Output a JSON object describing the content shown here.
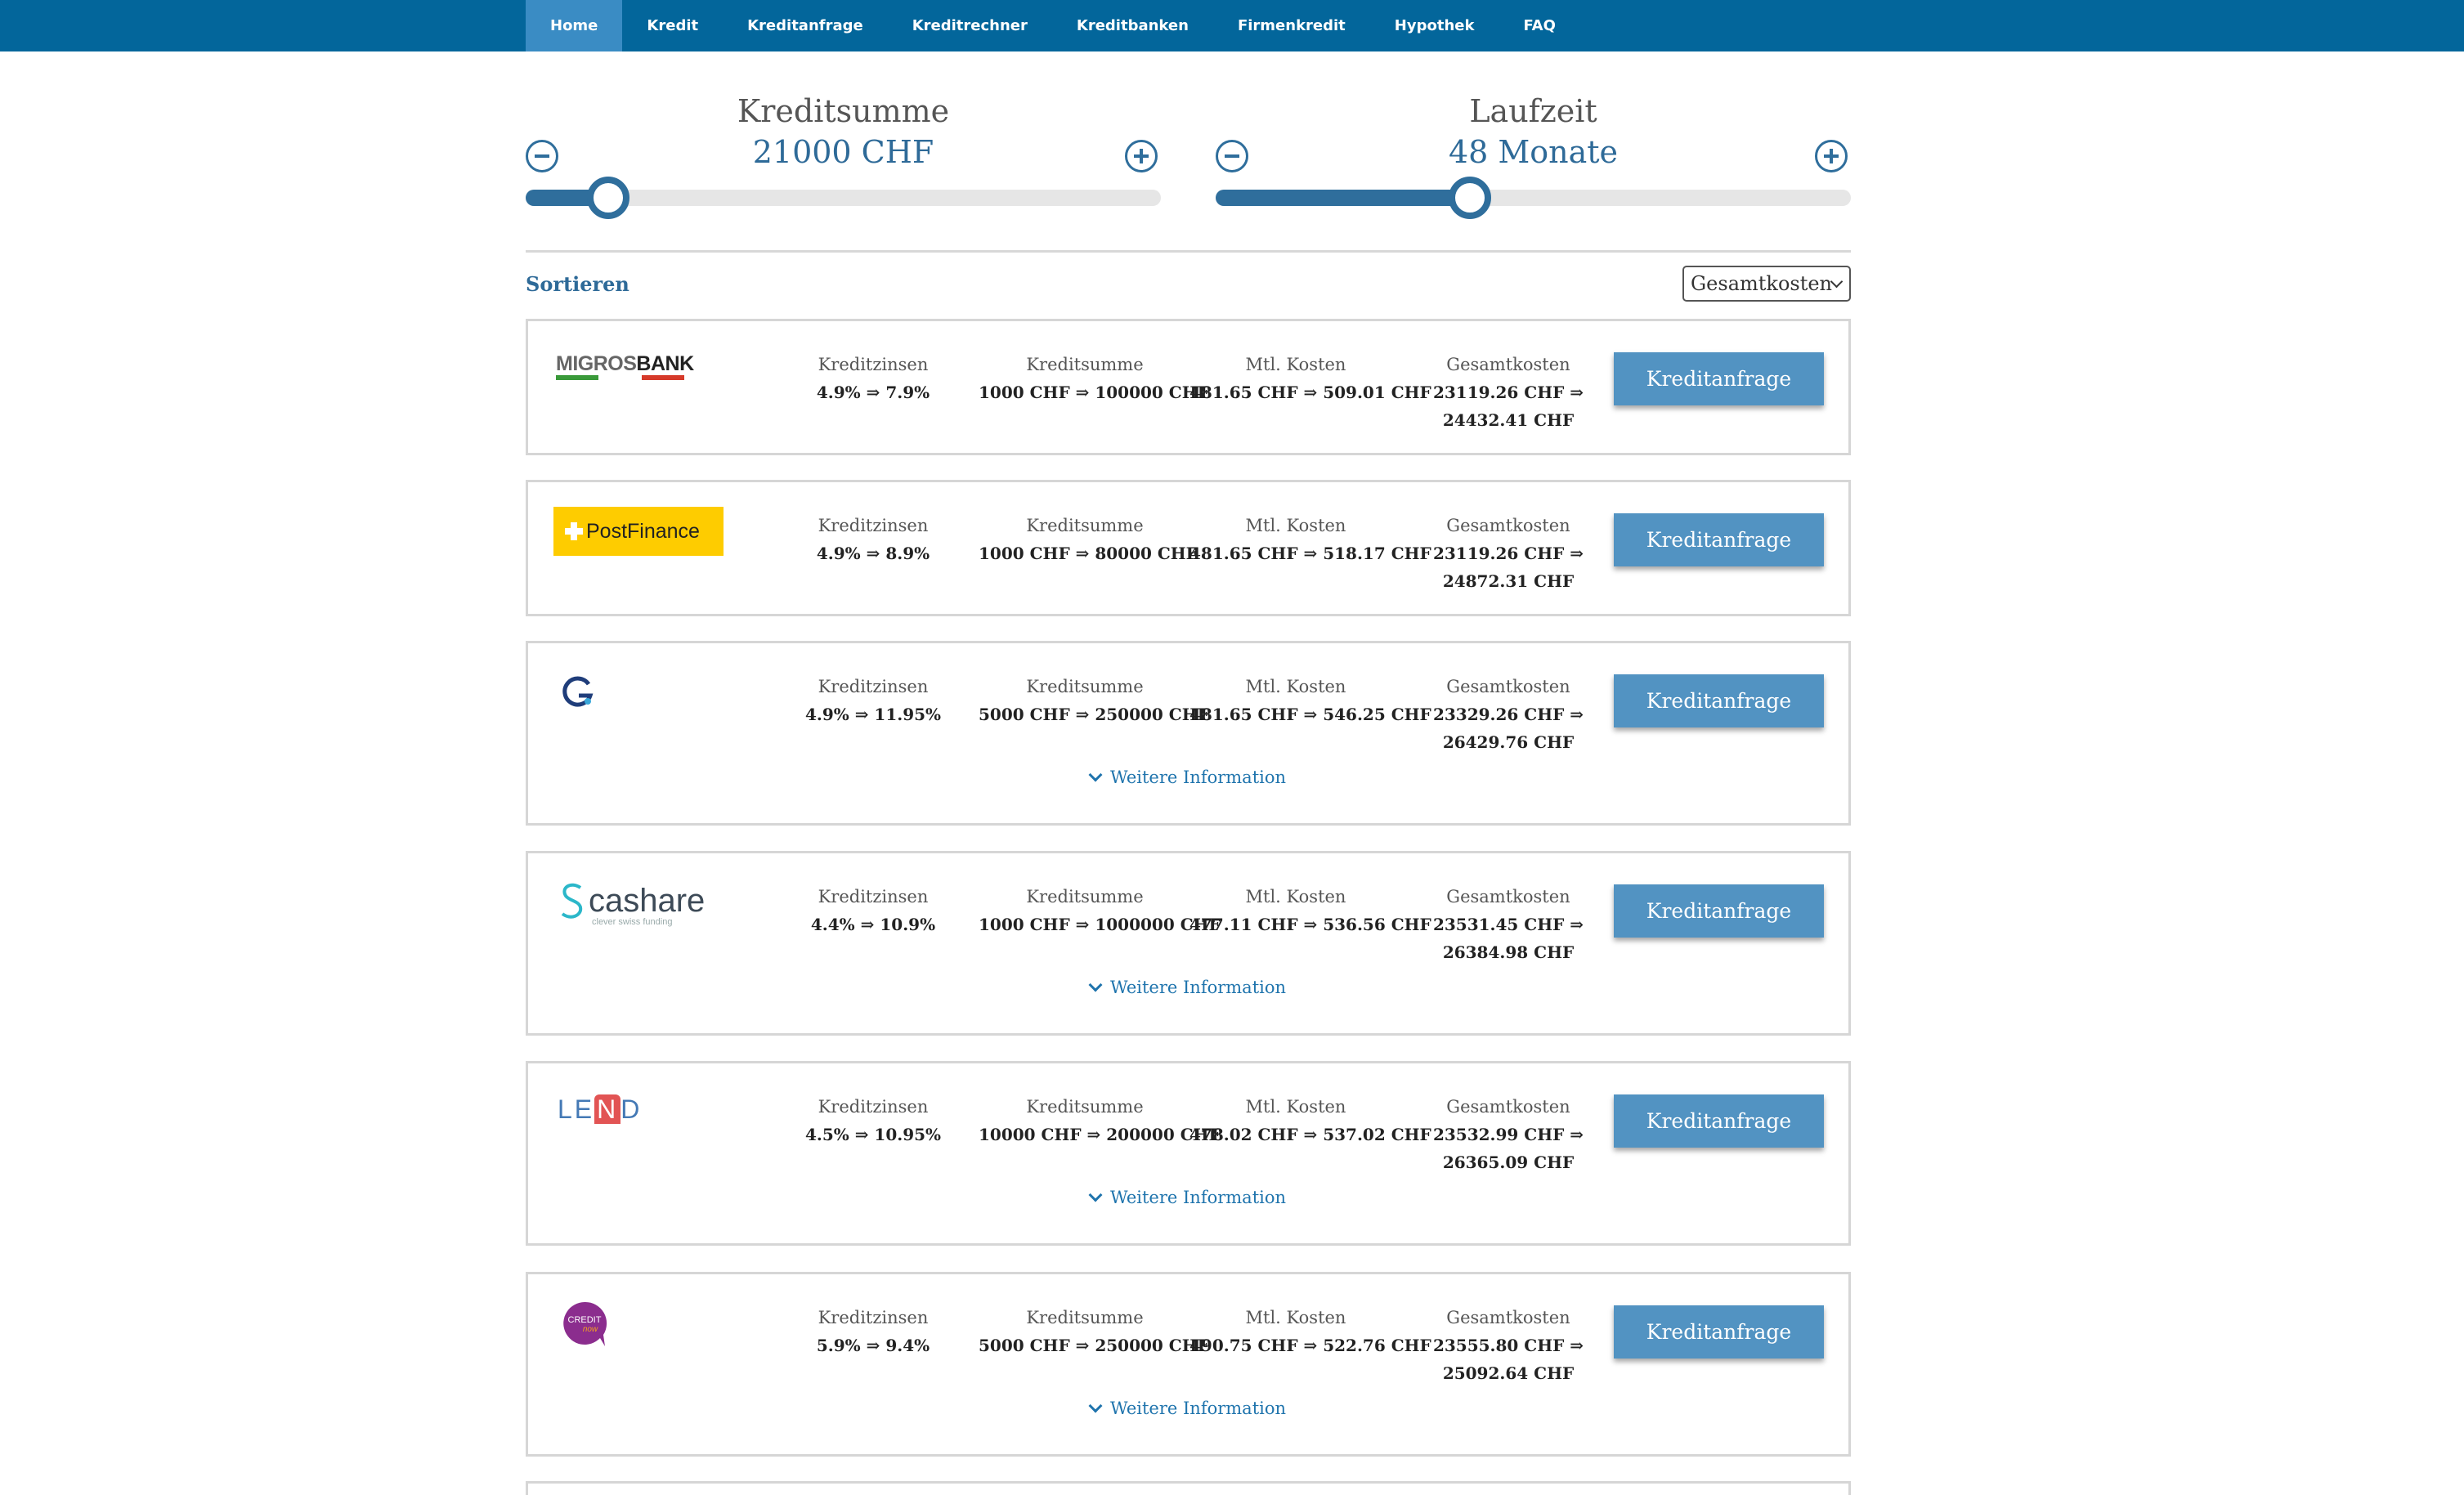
{
  "nav": {
    "items": [
      "Home",
      "Kredit",
      "Kreditanfrage",
      "Kreditrechner",
      "Kreditbanken",
      "Firmenkredit",
      "Hypothek",
      "FAQ"
    ],
    "active_index": 0
  },
  "sliders": {
    "amount": {
      "title": "Kreditsumme",
      "value": "21000 CHF",
      "level": 0.13
    },
    "term": {
      "title": "Laufzeit",
      "value": "48 Monate",
      "level": 0.4
    }
  },
  "sort": {
    "label": "Sortieren",
    "selected": "Gesamtkosten"
  },
  "column_labels": {
    "zinsen": "Kreditzinsen",
    "summe": "Kreditsumme",
    "kosten": "Mtl. Kosten",
    "gesamt": "Gesamtkosten"
  },
  "button_label": "Kreditanfrage",
  "more_label": "Weitere Information",
  "offers": [
    {
      "logo": "MIGROSBANK",
      "logo_a": "MIGROS",
      "logo_b": "BANK",
      "zinsen": "4.9% ⇒ 7.9%",
      "summe": "1000 CHF ⇒ 100000 CHF",
      "kosten": "481.65 CHF ⇒ 509.01 CHF",
      "gesamt1": "23119.26 CHF ⇒",
      "gesamt2": "24432.41 CHF"
    },
    {
      "logo": "PostFinance",
      "zinsen": "4.9% ⇒ 8.9%",
      "summe": "1000 CHF ⇒ 80000 CHF",
      "kosten": "481.65 CHF ⇒ 518.17 CHF",
      "gesamt1": "23119.26 CHF ⇒",
      "gesamt2": "24872.31 CHF"
    },
    {
      "logo": "G",
      "zinsen": "4.9% ⇒ 11.95%",
      "summe": "5000 CHF ⇒ 250000 CHF",
      "kosten": "481.65 CHF ⇒ 546.25 CHF",
      "gesamt1": "23329.26 CHF ⇒",
      "gesamt2": "26429.76 CHF"
    },
    {
      "logo": "cashare",
      "logo_sub": "clever swiss funding",
      "zinsen": "4.4% ⇒ 10.9%",
      "summe": "1000 CHF ⇒ 1000000 CHF",
      "kosten": "477.11 CHF ⇒ 536.56 CHF",
      "gesamt1": "23531.45 CHF ⇒",
      "gesamt2": "26384.98 CHF"
    },
    {
      "logo": "LEND",
      "logo_a": "LE",
      "logo_n": "N",
      "logo_b": "D",
      "zinsen": "4.5% ⇒ 10.95%",
      "summe": "10000 CHF ⇒ 200000 CHF",
      "kosten": "478.02 CHF ⇒ 537.02 CHF",
      "gesamt1": "23532.99 CHF ⇒",
      "gesamt2": "26365.09 CHF"
    },
    {
      "logo": "CREDIT now",
      "logo_a": "CREDIT",
      "logo_b": "now",
      "zinsen": "5.9% ⇒ 9.4%",
      "summe": "5000 CHF ⇒ 250000 CHF",
      "kosten": "490.75 CHF ⇒ 522.76 CHF",
      "gesamt1": "23555.80 CHF ⇒",
      "gesamt2": "25092.64 CHF"
    }
  ],
  "colors": {
    "nav_bg": "#03669b",
    "nav_active": "#3a8cc4",
    "accent": "#2f6e9c",
    "button": "#5293c2",
    "link": "#1f74ad"
  }
}
